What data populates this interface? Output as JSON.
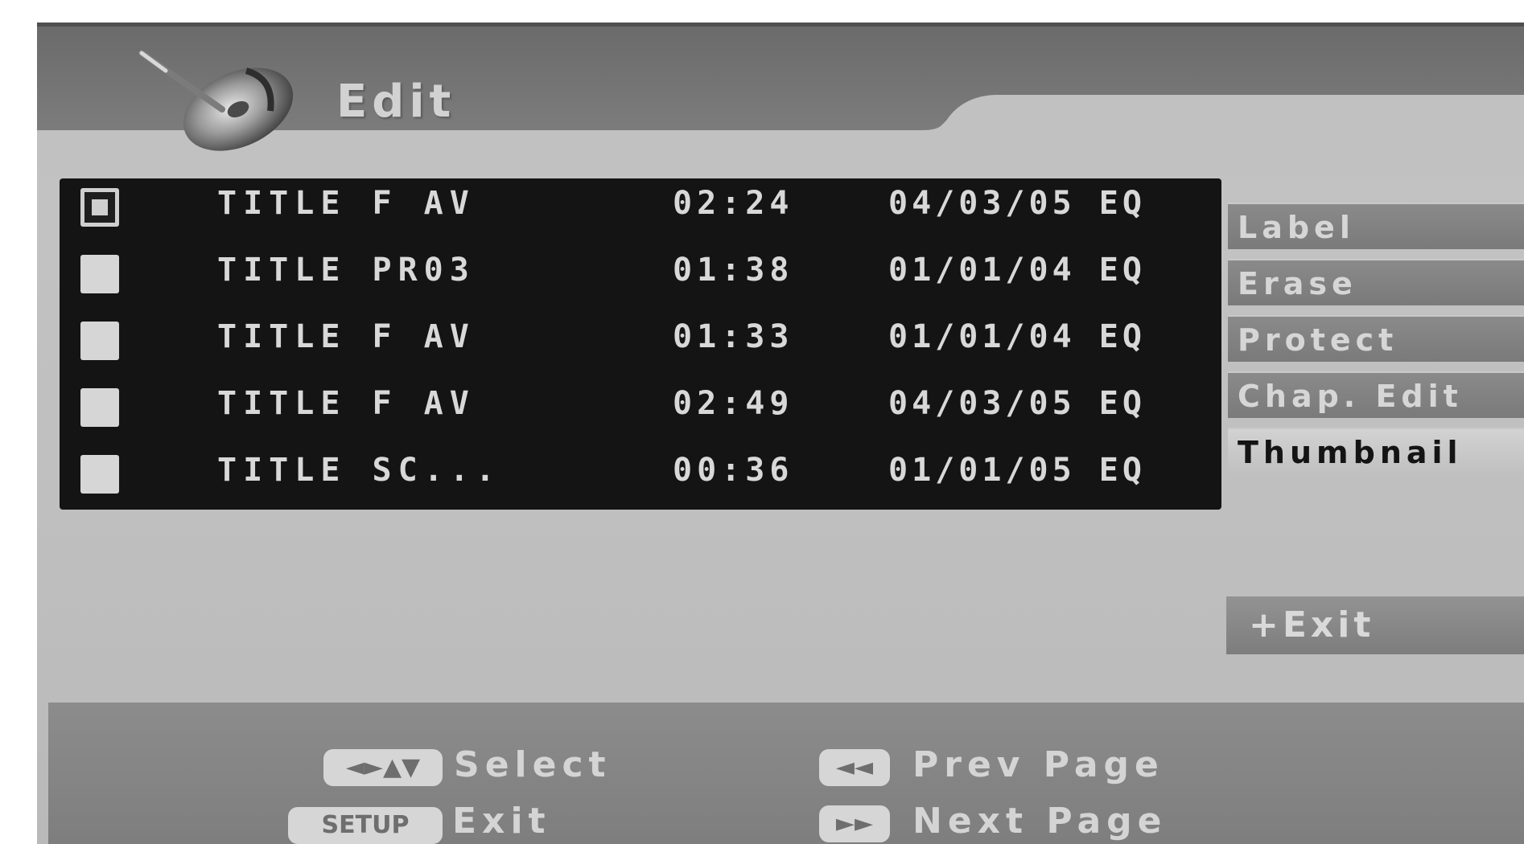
{
  "header": {
    "title": "Edit",
    "icon": "disc-edit-icon"
  },
  "title_list": {
    "rows": [
      {
        "name": "TITLE F AV",
        "length": "02:24",
        "date": "04/03/05 EQ",
        "checked": true
      },
      {
        "name": "TITLE PR03",
        "length": "01:38",
        "date": "01/01/04 EQ",
        "checked": false
      },
      {
        "name": "TITLE F AV",
        "length": "01:33",
        "date": "01/01/04 EQ",
        "checked": false
      },
      {
        "name": "TITLE F AV",
        "length": "02:49",
        "date": "04/03/05 EQ",
        "checked": false
      },
      {
        "name": "TITLE SC...",
        "length": "00:36",
        "date": "01/01/05 EQ",
        "checked": false
      }
    ]
  },
  "side_menu": {
    "items": [
      {
        "label": "Label",
        "active": false
      },
      {
        "label": "Erase",
        "active": false
      },
      {
        "label": "Protect",
        "active": false
      },
      {
        "label": "Chap. Edit",
        "active": false
      },
      {
        "label": "Thumbnail",
        "active": true
      }
    ],
    "exit_label": "+Exit"
  },
  "help": {
    "select_key": "◄►▲▼",
    "select_label": "Select",
    "setup_key": "SETUP",
    "exit_label": "Exit",
    "prev_key": "◄◄",
    "prev_label": "Prev Page",
    "next_key": "►►",
    "next_label": "Next Page"
  },
  "colors": {
    "header_dark": "#6f6f6f",
    "list_background": "#141414",
    "panel_background": "#c0c0c0"
  }
}
